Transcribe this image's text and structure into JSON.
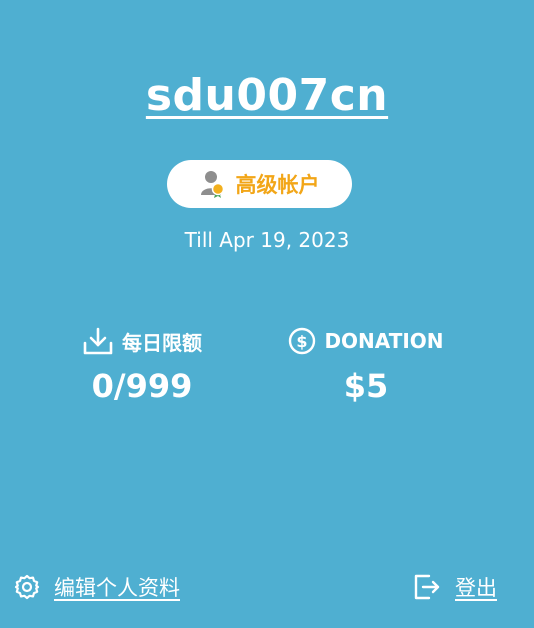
{
  "profile": {
    "username": "sdu007cn",
    "badge_label": "高级帐户",
    "badge_icon": "premium-user-icon",
    "expiry_text": "Till Apr 19, 2023"
  },
  "stats": {
    "daily_limit": {
      "label": "每日限额",
      "icon": "download-icon",
      "value": "0/999"
    },
    "donation": {
      "label": "DONATION",
      "icon": "dollar-circle-icon",
      "value": "$5"
    }
  },
  "footer": {
    "edit_profile_label": "编辑个人资料",
    "edit_profile_icon": "gear-icon",
    "logout_label": "登出",
    "logout_icon": "logout-icon"
  },
  "colors": {
    "background": "#4fafd1",
    "badge_text": "#f2a618",
    "text": "#ffffff"
  }
}
